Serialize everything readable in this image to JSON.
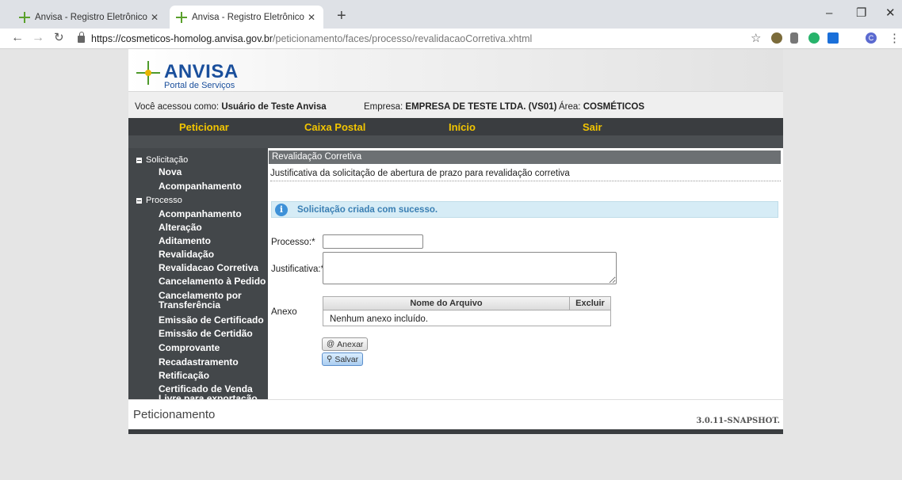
{
  "browser": {
    "tabs": [
      {
        "label": "Anvisa - Registro Eletrônico de C"
      },
      {
        "label": "Anvisa - Registro Eletrônico de C"
      }
    ],
    "new_tab_label": "+",
    "window": {
      "minimize": "–",
      "maximize": "❐",
      "close": "✕"
    },
    "url_host": "https://cosmeticos-homolog.anvisa.gov.br",
    "url_path": "/peticionamento/faces/processo/revalidacaoCorretiva.xhtml",
    "profile_initial": "C",
    "extension_colors": [
      "#7b6b3a",
      "#777777",
      "#27b36b",
      "#1a6fd9"
    ]
  },
  "header": {
    "logo_title": "ANVISA",
    "logo_subtitle": "Portal de Serviços"
  },
  "userbar": {
    "user_label": "Você acessou como:",
    "user_value": "Usuário de Teste Anvisa",
    "company_label": "Empresa:",
    "company_value": "EMPRESA DE TESTE LTDA. (VS01)",
    "area_label": "Área:",
    "area_value": "COSMÉTICOS"
  },
  "mainnav": {
    "items": [
      "Peticionar",
      "Caixa Postal",
      "Início",
      "Sair"
    ]
  },
  "sidebar": {
    "groups": [
      {
        "label": "Solicitação",
        "items": [
          "Nova",
          "Acompanhamento"
        ]
      },
      {
        "label": "Processo",
        "items": [
          "Acompanhamento",
          "Alteração",
          "Aditamento",
          "Revalidação",
          "Revalidacao Corretiva",
          "Cancelamento à Pedido",
          "Cancelamento por Transferência",
          "Emissão de Certificado",
          "Emissão de Certidão",
          "Comprovante",
          "Recadastramento",
          "Retificação",
          "Certificado de Venda Livre para exportação"
        ]
      }
    ]
  },
  "main": {
    "panel_title": "Revalidação Corretiva",
    "panel_description": "Justificativa da solicitação de abertura de prazo para revalidação corretiva",
    "success_message": "Solicitação criada com sucesso.",
    "form": {
      "processo_label": "Processo:*",
      "processo_value": "",
      "justificativa_label": "Justificativa:*",
      "justificativa_value": "",
      "anexo_label": "Anexo"
    },
    "anexo_table": {
      "columns": [
        "Nome do Arquivo",
        "Excluir"
      ],
      "empty_text": "Nenhum anexo incluído."
    },
    "buttons": {
      "anexar": "Anexar",
      "salvar": "Salvar"
    }
  },
  "footer": {
    "title": "Peticionamento",
    "version": "3.0.11-SNAPSHOT."
  }
}
